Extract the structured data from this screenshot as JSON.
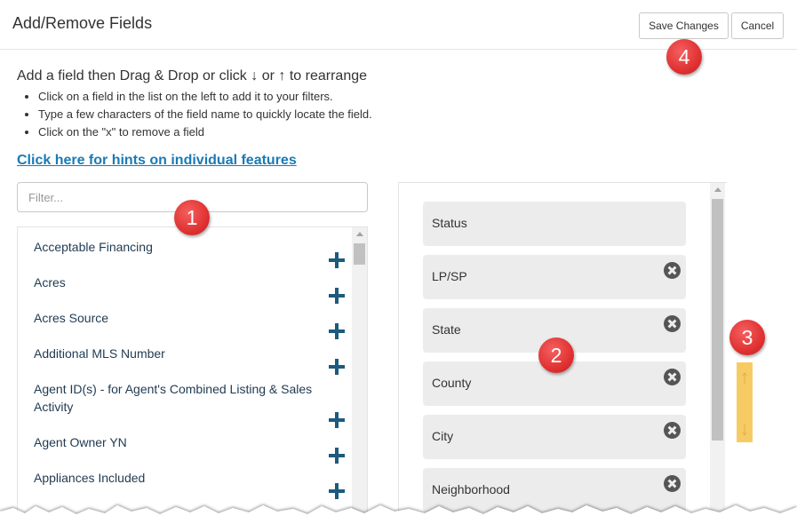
{
  "dialog": {
    "title": "Add/Remove Fields",
    "save_label": "Save Changes",
    "cancel_label": "Cancel"
  },
  "instructions": {
    "title_prefix": "Add a field then Drag & Drop or click",
    "down_arrow": "↓",
    "or_text": "or",
    "up_arrow": "↑",
    "title_suffix": "to rearrange",
    "bullets": [
      "Click on a field in the list on the left to add it to your filters.",
      "Type a few characters of the field name to quickly locate the field.",
      "Click on the \"x\" to remove a field"
    ]
  },
  "hints_link": "Click here for hints on individual features",
  "filter": {
    "placeholder": "Filter..."
  },
  "available_fields": [
    "Acceptable Financing",
    "Acres",
    "Acres Source",
    "Additional MLS Number",
    "Agent ID(s) - for Agent's Combined Listing & Sales Activity",
    "Agent Owner YN",
    "Appliances Included"
  ],
  "selected_fields": [
    {
      "label": "Status",
      "removable": false
    },
    {
      "label": "LP/SP",
      "removable": true
    },
    {
      "label": "State",
      "removable": true
    },
    {
      "label": "County",
      "removable": true
    },
    {
      "label": "City",
      "removable": true
    },
    {
      "label": "Neighborhood",
      "removable": true
    }
  ],
  "reorder": {
    "up": "↑",
    "down": "↓"
  },
  "callouts": [
    "1",
    "2",
    "3",
    "4"
  ],
  "colors": {
    "link": "#1a7ab5",
    "add_icon": "#1e5a7d",
    "badge": "#e03232",
    "reorder_highlight": "#f6c34a"
  }
}
